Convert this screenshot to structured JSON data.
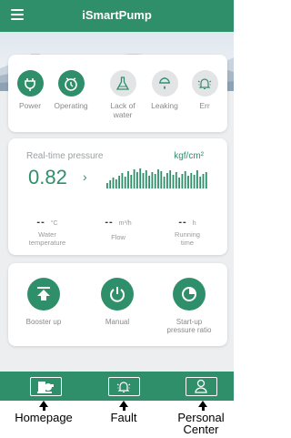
{
  "app": {
    "title": "iSmartPump"
  },
  "status": {
    "items": [
      {
        "label": "Power",
        "active": true
      },
      {
        "label": "Operating",
        "active": true
      },
      {
        "label": "Lack of\nwater",
        "active": false
      },
      {
        "label": "Leaking",
        "active": false
      },
      {
        "label": "Err",
        "active": false
      }
    ]
  },
  "pressure": {
    "title": "Real-time pressure",
    "unit": "kgf/cm²",
    "value": "0.82",
    "arrow": "›"
  },
  "metrics": [
    {
      "value": "--",
      "unit": "°C",
      "label": "Water\ntemperature"
    },
    {
      "value": "--",
      "unit": "m³/h",
      "label": "Flow"
    },
    {
      "value": "--",
      "unit": "h",
      "label": "Running\ntime"
    }
  ],
  "controls": [
    {
      "label": "Booster up"
    },
    {
      "label": "Manual"
    },
    {
      "label": "Start-up\npressure ratio"
    }
  ],
  "bottom_nav": [
    {
      "label": "Homepage"
    },
    {
      "label": "Fault"
    },
    {
      "label": "Personal\nCenter"
    }
  ],
  "colors": {
    "primary": "#2f8f6b",
    "muted": "#e2e4e5",
    "background": "#eceeef"
  },
  "icons": [
    "menu-icon",
    "power-icon",
    "clock-icon",
    "flask-icon",
    "drop-icon",
    "alarm-bell-icon",
    "up-arrow-icon",
    "power-button-icon",
    "pie-chart-icon",
    "pump-icon",
    "user-icon"
  ]
}
